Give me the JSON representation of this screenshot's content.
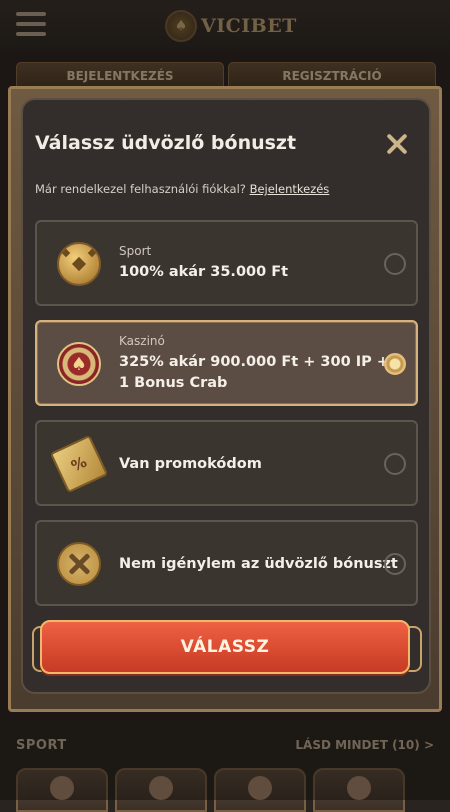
{
  "app": {
    "logo_text": "VICIBET",
    "logo_mark": "♠"
  },
  "header": {
    "login_tab": "BEJELENTKEZÉS",
    "register_tab": "REGISZTRÁCIÓ"
  },
  "background": {
    "section_title": "SPORT",
    "see_all": "LÁSD MINDET (10)"
  },
  "modal": {
    "title": "Válassz üdvözlő bónuszt",
    "account_text": "Már rendelkezel felhasználói fiókkal?",
    "login_link": "Bejelentkezés",
    "options": [
      {
        "category": "Sport",
        "label": "100% akár 35.000 Ft",
        "icon": "soccer-ball-icon",
        "selected": false
      },
      {
        "category": "Kaszinó",
        "label": "325% akár 900.000 Ft + 300 IP + 1 Bonus Crab",
        "icon": "casino-chip-icon",
        "selected": true
      },
      {
        "category": "",
        "label": "Van promokódom",
        "icon": "promo-ticket-icon",
        "selected": false
      },
      {
        "category": "",
        "label": "Nem igénylem az üdvözlő bónuszt",
        "icon": "decline-icon",
        "selected": false
      }
    ],
    "choose_button": "VÁLASSZ"
  },
  "colors": {
    "accent": "#d6b27e",
    "button": "#e4533a",
    "modal_bg": "#332e2b"
  }
}
